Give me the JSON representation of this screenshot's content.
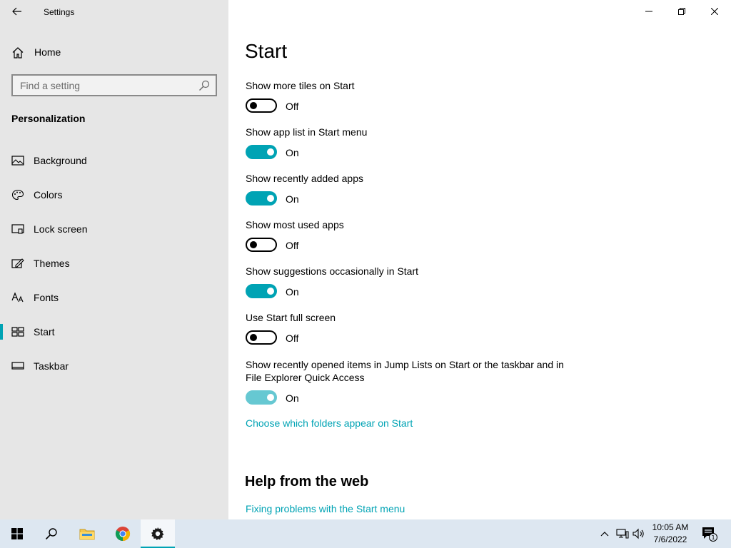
{
  "window": {
    "title": "Settings"
  },
  "sidebar": {
    "home_label": "Home",
    "search_placeholder": "Find a setting",
    "section_title": "Personalization",
    "items": [
      {
        "label": "Background",
        "icon": "image-icon"
      },
      {
        "label": "Colors",
        "icon": "palette-icon"
      },
      {
        "label": "Lock screen",
        "icon": "lock-screen-icon"
      },
      {
        "label": "Themes",
        "icon": "themes-icon"
      },
      {
        "label": "Fonts",
        "icon": "fonts-icon"
      },
      {
        "label": "Start",
        "icon": "start-icon",
        "selected": true
      },
      {
        "label": "Taskbar",
        "icon": "taskbar-icon"
      }
    ]
  },
  "main": {
    "title": "Start",
    "settings": [
      {
        "label": "Show more tiles on Start",
        "state": "Off"
      },
      {
        "label": "Show app list in Start menu",
        "state": "On"
      },
      {
        "label": "Show recently added apps",
        "state": "On"
      },
      {
        "label": "Show most used apps",
        "state": "Off"
      },
      {
        "label": "Show suggestions occasionally in Start",
        "state": "On"
      },
      {
        "label": "Use Start full screen",
        "state": "Off"
      },
      {
        "label": "Show recently opened items in Jump Lists on Start or the taskbar and in File Explorer Quick Access",
        "state": "On"
      }
    ],
    "folders_link": "Choose which folders appear on Start",
    "help_title": "Help from the web",
    "help_link": "Fixing problems with the Start menu"
  },
  "taskbar": {
    "time": "10:05 AM",
    "date": "7/6/2022",
    "notification_count": "1"
  },
  "colors": {
    "accent": "#00a3b4",
    "sidebar_bg": "#e6e6e6",
    "taskbar_bg": "#dde7f1"
  }
}
